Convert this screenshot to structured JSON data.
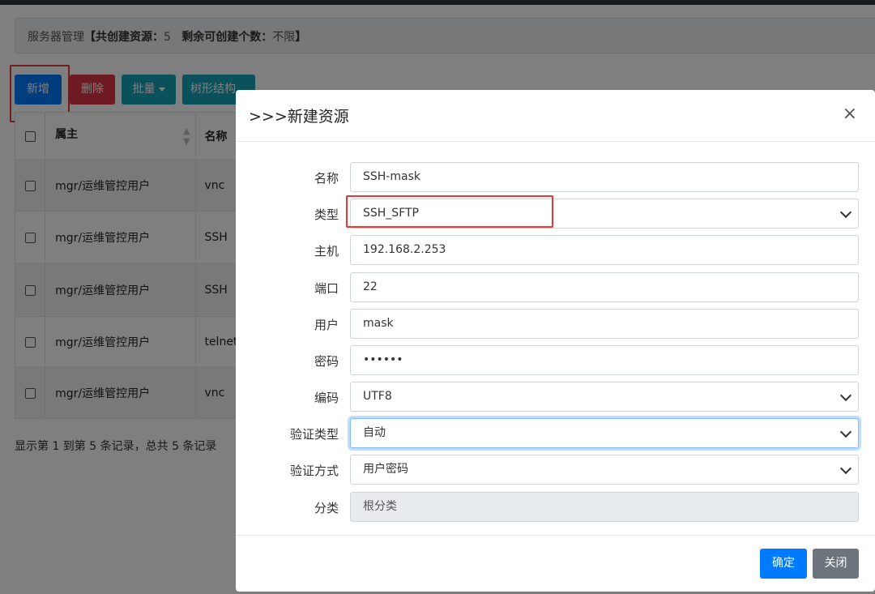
{
  "header": {
    "prefix": "服务器管理",
    "open_bracket": "【",
    "total_label": "共创建资源：",
    "total_value": "5",
    "remaining_label": "剩余可创建个数：",
    "remaining_value": "不限",
    "close_bracket": "】"
  },
  "toolbar": {
    "add": "新增",
    "delete": "删除",
    "batch": "批量",
    "tree": "树形结构"
  },
  "table": {
    "headers": [
      "属主",
      "名称"
    ],
    "rows": [
      {
        "owner": "mgr/运维管控用户",
        "name": "vnc"
      },
      {
        "owner": "mgr/运维管控用户",
        "name": "SSH"
      },
      {
        "owner": "mgr/运维管控用户",
        "name": "SSH"
      },
      {
        "owner": "mgr/运维管控用户",
        "name": "telnet"
      },
      {
        "owner": "mgr/运维管控用户",
        "name": "vnc"
      }
    ]
  },
  "pagination": {
    "summary": "显示第 1 到第 5 条记录，总共 5 条记录"
  },
  "modal": {
    "title": ">>>新建资源",
    "close_glyph": "×",
    "fields": {
      "name": {
        "label": "名称",
        "value": "SSH-mask"
      },
      "type": {
        "label": "类型",
        "value": "SSH_SFTP"
      },
      "host": {
        "label": "主机",
        "value": "192.168.2.253"
      },
      "port": {
        "label": "端口",
        "value": "22"
      },
      "user": {
        "label": "用户",
        "value": "mask"
      },
      "password": {
        "label": "密码",
        "value": "••••••"
      },
      "encoding": {
        "label": "编码",
        "value": "UTF8"
      },
      "auth_type": {
        "label": "验证类型",
        "value": "自动"
      },
      "auth_method": {
        "label": "验证方式",
        "value": "用户密码"
      },
      "category": {
        "label": "分类",
        "value": "根分类"
      }
    },
    "ok": "确定",
    "close": "关闭"
  },
  "colors": {
    "primary": "#007bff",
    "danger": "#dc3545",
    "info": "#17a2b8",
    "secondary": "#6c757d",
    "highlight": "#e53935"
  }
}
